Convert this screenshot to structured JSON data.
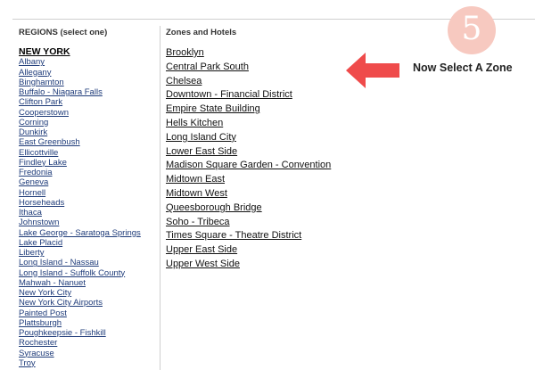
{
  "regions_panel": {
    "header": "REGIONS (select one)",
    "items": [
      {
        "label": "NEW YORK",
        "selected": true
      },
      {
        "label": "Albany"
      },
      {
        "label": "Allegany"
      },
      {
        "label": "Binghamton"
      },
      {
        "label": "Buffalo - Niagara Falls"
      },
      {
        "label": "Clifton Park"
      },
      {
        "label": "Cooperstown"
      },
      {
        "label": "Corning"
      },
      {
        "label": "Dunkirk"
      },
      {
        "label": "East Greenbush"
      },
      {
        "label": "Ellicottville"
      },
      {
        "label": "Findley Lake"
      },
      {
        "label": "Fredonia"
      },
      {
        "label": "Geneva"
      },
      {
        "label": "Hornell"
      },
      {
        "label": "Horseheads"
      },
      {
        "label": "Ithaca"
      },
      {
        "label": "Johnstown"
      },
      {
        "label": "Lake George - Saratoga Springs"
      },
      {
        "label": "Lake Placid"
      },
      {
        "label": "Liberty"
      },
      {
        "label": "Long Island - Nassau"
      },
      {
        "label": "Long Island - Suffolk County"
      },
      {
        "label": "Mahwah - Nanuet"
      },
      {
        "label": "New York City"
      },
      {
        "label": "New York City Airports"
      },
      {
        "label": "Painted Post"
      },
      {
        "label": "Plattsburgh"
      },
      {
        "label": "Poughkeepsie - Fishkill"
      },
      {
        "label": "Rochester"
      },
      {
        "label": "Syracuse"
      },
      {
        "label": "Troy"
      }
    ]
  },
  "zones_panel": {
    "header": "Zones and Hotels",
    "items": [
      {
        "label": "Brooklyn"
      },
      {
        "label": "Central Park South"
      },
      {
        "label": "Chelsea"
      },
      {
        "label": "Downtown - Financial District"
      },
      {
        "label": "Empire State Building"
      },
      {
        "label": "Hells Kitchen"
      },
      {
        "label": "Long Island City"
      },
      {
        "label": "Lower East Side"
      },
      {
        "label": "Madison Square Garden - Convention"
      },
      {
        "label": "Midtown East"
      },
      {
        "label": "Midtown West"
      },
      {
        "label": "Queesborough Bridge"
      },
      {
        "label": "Soho - Tribeca"
      },
      {
        "label": "Times Square - Theatre District"
      },
      {
        "label": "Upper East Side"
      },
      {
        "label": "Upper West Side"
      }
    ]
  },
  "annotation": {
    "step_number": "5",
    "callout_text": "Now Select A Zone",
    "badge_color": "#f7c9c0",
    "arrow_color": "#ef4b4b",
    "arrow_icon": "arrow-left-icon"
  }
}
